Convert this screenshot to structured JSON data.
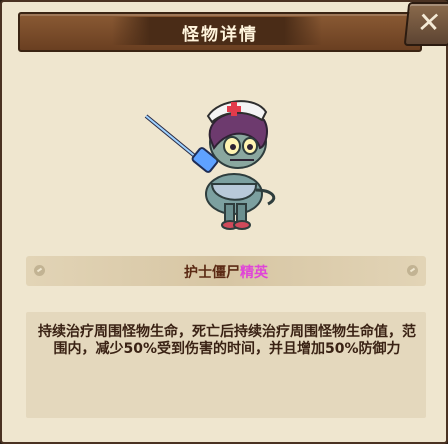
{
  "window": {
    "title": "怪物详情"
  },
  "close_button": {
    "label": "✕"
  },
  "monster": {
    "name": "护士僵尸",
    "tier": "精英",
    "description": "持续治疗周围怪物生命，死亡后持续治疗周围怪物生命值，范围内，减少50%受到伤害的时间，并且增加50%防御力"
  },
  "colors": {
    "frame": "#4a3222",
    "title_bar": "#7a4a28",
    "panel": "#efe6cf",
    "name": "#5b2a14",
    "tier": "#e045d8"
  },
  "icons": {
    "close": "close-icon",
    "portrait": "nurse-zombie-portrait",
    "dots": "pin-icon"
  }
}
